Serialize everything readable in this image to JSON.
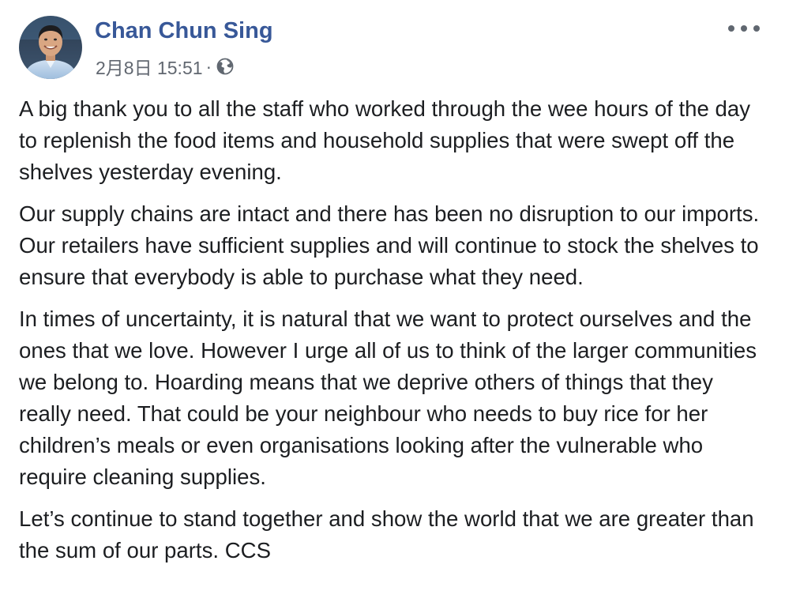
{
  "author": {
    "name": "Chan Chun Sing"
  },
  "meta": {
    "time": "2月8日 15:51",
    "separator": "·",
    "audience_icon": "globe-icon"
  },
  "menu": {
    "icon": "more-options-icon"
  },
  "post": {
    "paragraphs": [
      "A big thank you to all the staff who worked through the wee hours of the day to replenish the food items and household supplies that were swept off the shelves yesterday evening.",
      "Our supply chains are intact and there has been no disruption to our imports. Our retailers have sufficient supplies and will continue to stock the shelves to ensure that everybody is able to purchase what they need.",
      "In times of uncertainty, it is natural that we want to protect ourselves and the ones that we love. However I urge all of us to think of the larger communities we belong to. Hoarding means that we deprive others of things that they really need. That could be your neighbour who needs to buy rice for her children’s meals or even organisations looking after the vulnerable who require cleaning supplies.",
      "Let’s continue to stand together and show the world that we are greater than the sum of our parts. CCS"
    ]
  },
  "colors": {
    "author_link": "#385898",
    "meta_text": "#616770",
    "body_text": "#1c1e21",
    "background": "#ffffff"
  }
}
